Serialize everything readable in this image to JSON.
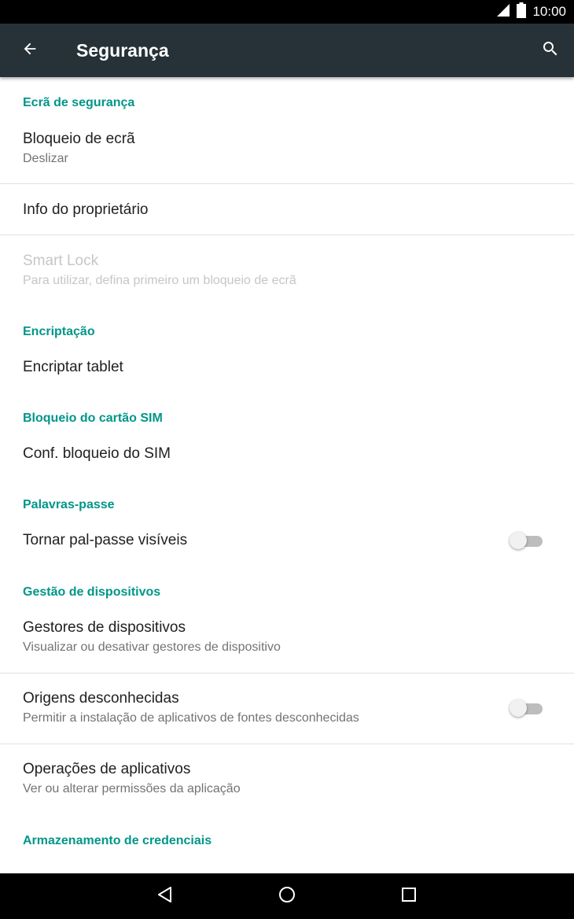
{
  "status_bar": {
    "time": "10:00",
    "signal_icon": "signal-icon",
    "battery_icon": "battery-icon"
  },
  "app_bar": {
    "title": "Segurança",
    "back_icon": "arrow-back-icon",
    "search_icon": "search-icon"
  },
  "sections": {
    "screen_security": "Ecrã de segurança",
    "encryption": "Encriptação",
    "sim_lock": "Bloqueio do cartão SIM",
    "passwords": "Palavras-passe",
    "device_admin": "Gestão de dispositivos",
    "credential_storage": "Armazenamento de credenciais"
  },
  "items": {
    "screen_lock": {
      "title": "Bloqueio de ecrã",
      "summary": "Deslizar"
    },
    "owner_info": {
      "title": "Info do proprietário"
    },
    "smart_lock": {
      "title": "Smart Lock",
      "summary": "Para utilizar, defina primeiro um bloqueio de ecrã",
      "enabled": false
    },
    "encrypt_tablet": {
      "title": "Encriptar tablet"
    },
    "sim_lock_settings": {
      "title": "Conf. bloqueio do SIM"
    },
    "show_passwords": {
      "title": "Tornar pal-passe visíveis",
      "toggle_on": false
    },
    "device_administrators": {
      "title": "Gestores de dispositivos",
      "summary": "Visualizar ou desativar gestores de dispositivo"
    },
    "unknown_sources": {
      "title": "Origens desconhecidas",
      "summary": "Permitir a instalação de aplicativos de fontes desconhecidas",
      "toggle_on": false
    },
    "app_ops": {
      "title": "Operações de aplicativos",
      "summary": "Ver ou alterar permissões da aplicação"
    }
  },
  "colors": {
    "app_bar": "#263238",
    "accent": "#009688"
  },
  "nav_bar": {
    "back_icon": "nav-back-icon",
    "home_icon": "nav-home-icon",
    "recents_icon": "nav-recents-icon"
  }
}
